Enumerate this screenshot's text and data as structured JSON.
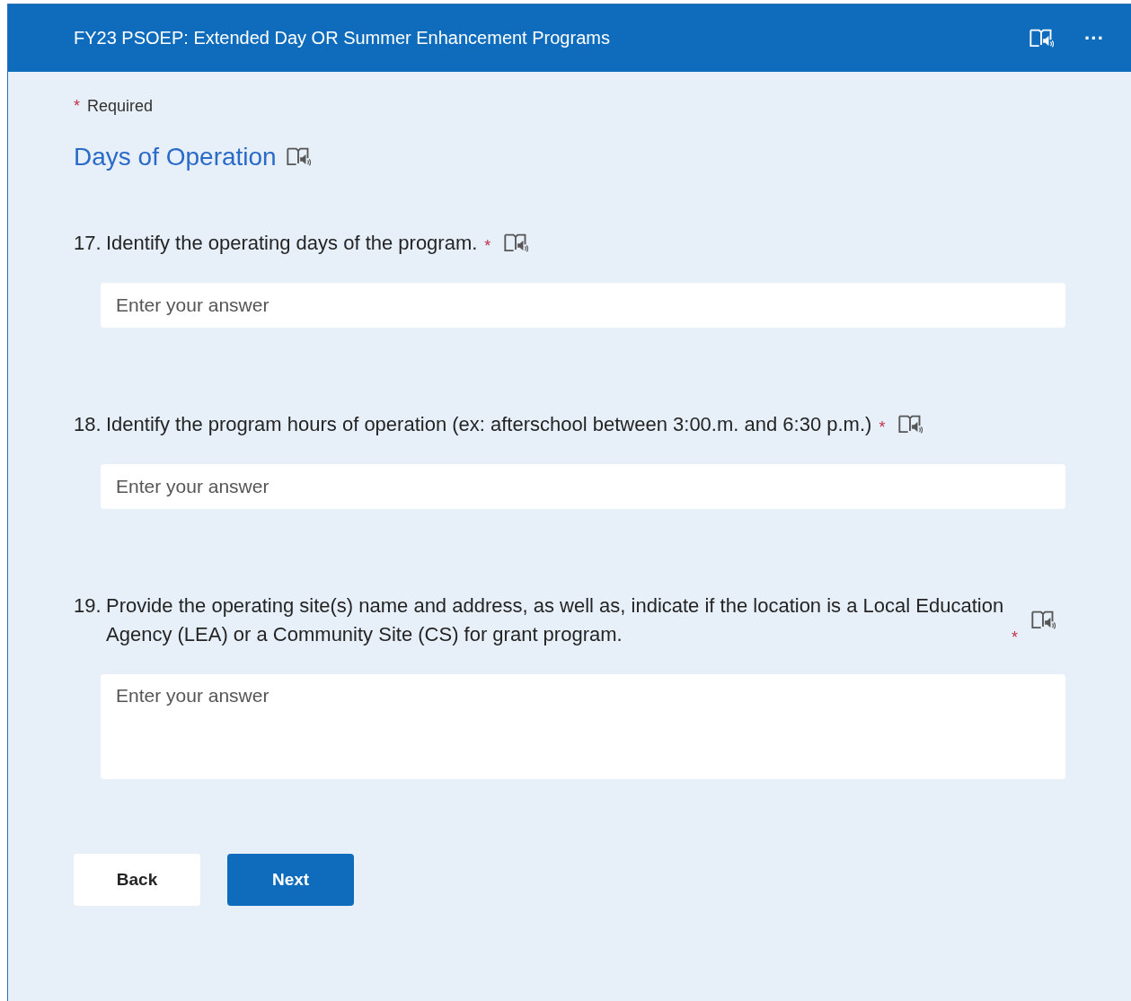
{
  "header": {
    "title": "FY23 PSOEP: Extended Day OR Summer Enhancement Programs",
    "more": "···"
  },
  "required_note": {
    "mark": "*",
    "label": "Required"
  },
  "section": {
    "title": "Days of Operation"
  },
  "questions": [
    {
      "number": "17.",
      "text": "Identify the operating days of the program.",
      "required_mark": "*",
      "field": {
        "kind": "line",
        "placeholder": "Enter your answer"
      }
    },
    {
      "number": "18.",
      "text": "Identify the program hours of operation (ex: afterschool between 3:00.m. and 6:30 p.m.)",
      "required_mark": "*",
      "field": {
        "kind": "line",
        "placeholder": "Enter your answer"
      }
    },
    {
      "number": "19.",
      "text": "Provide the operating site(s) name and address, as well as, indicate if the location is a Local Education Agency (LEA) or a Community Site (CS) for grant program.",
      "required_mark": "*",
      "field": {
        "kind": "area",
        "placeholder": "Enter your answer"
      }
    }
  ],
  "buttons": [
    {
      "label": "Back",
      "kind": "secondary"
    },
    {
      "label": "Next",
      "kind": "primary"
    }
  ]
}
